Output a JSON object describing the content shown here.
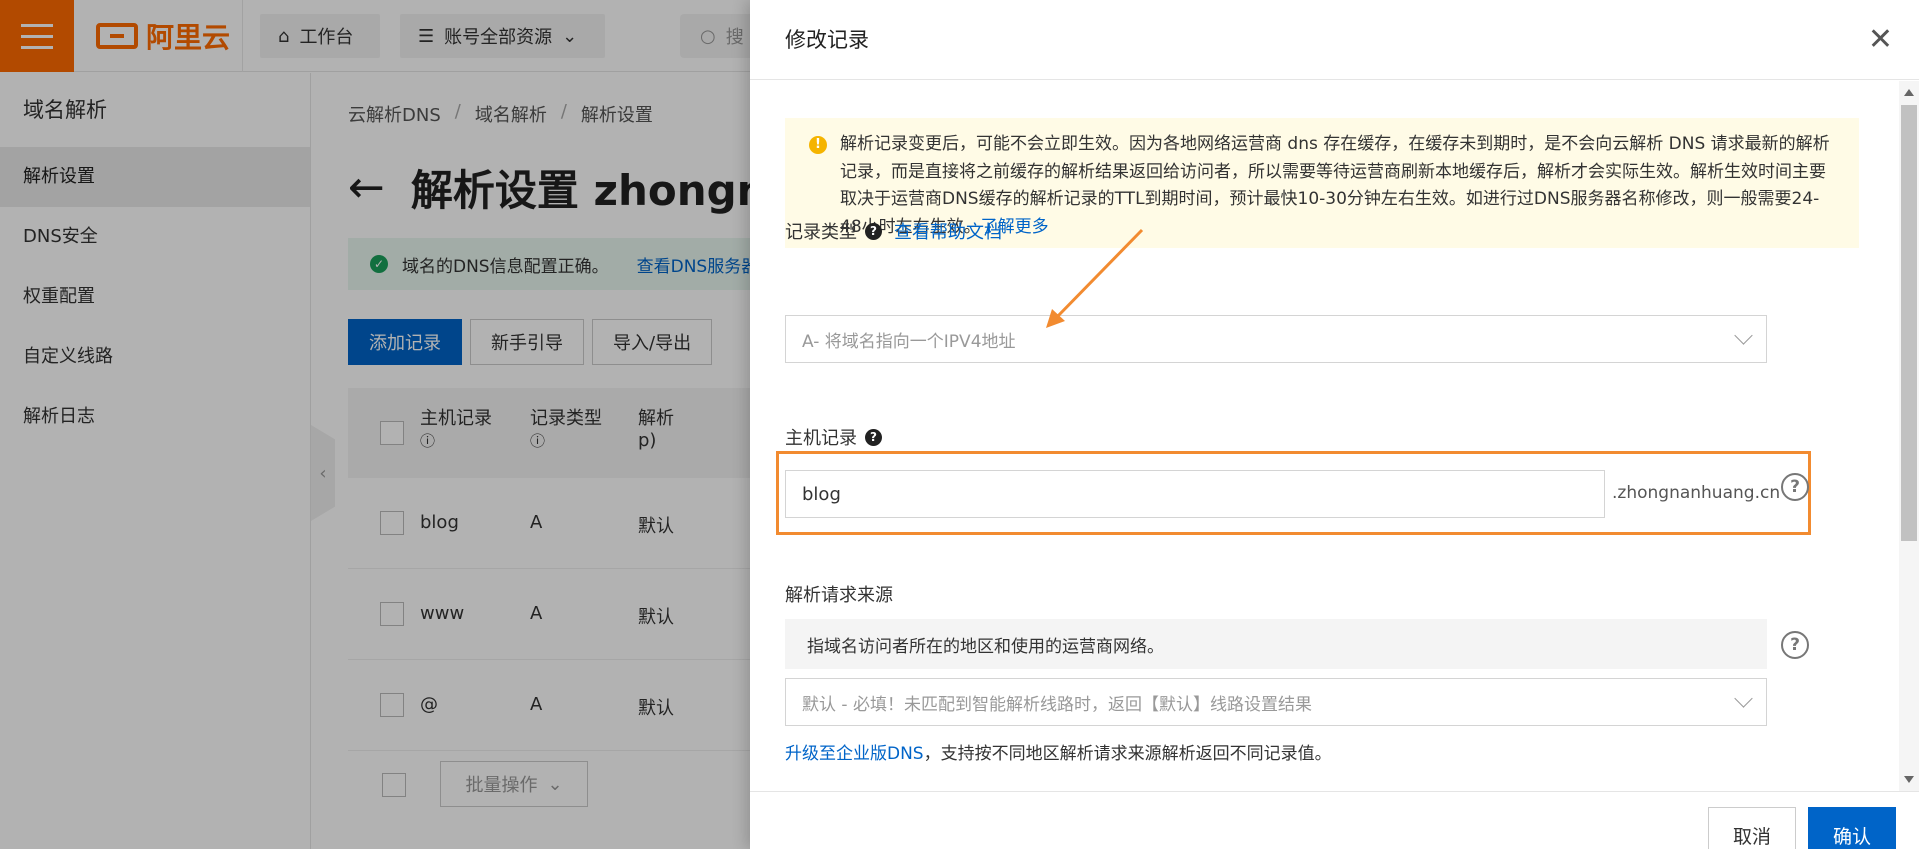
{
  "topbar": {
    "logo_text": "阿里云",
    "workbench_label": "工作台",
    "resources_label": "账号全部资源",
    "search_placeholder": "搜"
  },
  "sidebar": {
    "title": "域名解析",
    "items": [
      {
        "label": "解析设置",
        "active": true
      },
      {
        "label": "DNS安全",
        "active": false
      },
      {
        "label": "权重配置",
        "active": false
      },
      {
        "label": "自定义线路",
        "active": false
      },
      {
        "label": "解析日志",
        "active": false
      }
    ]
  },
  "main": {
    "breadcrumb": [
      "云解析DNS",
      "域名解析",
      "解析设置"
    ],
    "heading": "解析设置 zhongn",
    "dns_notice": "域名的DNS信息配置正确。",
    "dns_notice_link": "查看DNS服务器",
    "actions": [
      "添加记录",
      "新手引导",
      "导入/导出"
    ],
    "table": {
      "headers": [
        "主机记录",
        "记录类型",
        "解析"
      ],
      "header_extra": "p)",
      "rows": [
        {
          "host": "blog",
          "type": "A",
          "line": "默认"
        },
        {
          "host": "www",
          "type": "A",
          "line": "默认"
        },
        {
          "host": "@",
          "type": "A",
          "line": "默认"
        }
      ]
    },
    "batch_label": "批量操作"
  },
  "drawer": {
    "title": "修改记录",
    "warning_text": "解析记录变更后，可能不会立即生效。因为各地网络运营商 dns 存在缓存，在缓存未到期时，是不会向云解析 DNS 请求最新的解析记录，而是直接将之前缓存的解析结果返回给访问者，所以需要等待运营商刷新本地缓存后，解析才会实际生效。解析生效时间主要取决于运营商DNS缓存的解析记录的TTL到期时间，预计最快10-30分钟左右生效。如进行过DNS服务器名称修改，则一般需要24-48小时左右生效。",
    "warning_link": "了解更多",
    "record_type_label": "记录类型",
    "record_type_help_link": "查看帮助文档",
    "record_type_value": "A- 将域名指向一个IPV4地址",
    "host_label": "主机记录",
    "host_value": "blog",
    "host_suffix": ".zhongnanhuang.cn",
    "source_label": "解析请求来源",
    "source_desc": "指域名访问者所在的地区和使用的运营商网络。",
    "source_value": "默认 - 必填！未匹配到智能解析线路时，返回【默认】线路设置结果",
    "upgrade_link": "升级至企业版DNS",
    "upgrade_text": "，支持按不同地区解析请求来源解析返回不同记录值。",
    "cancel_label": "取消",
    "confirm_label": "确认"
  },
  "colors": {
    "brand": "#ff6a00",
    "primary": "#0064c8",
    "highlight": "#f28b30",
    "warning_bg": "#fffbe6"
  }
}
